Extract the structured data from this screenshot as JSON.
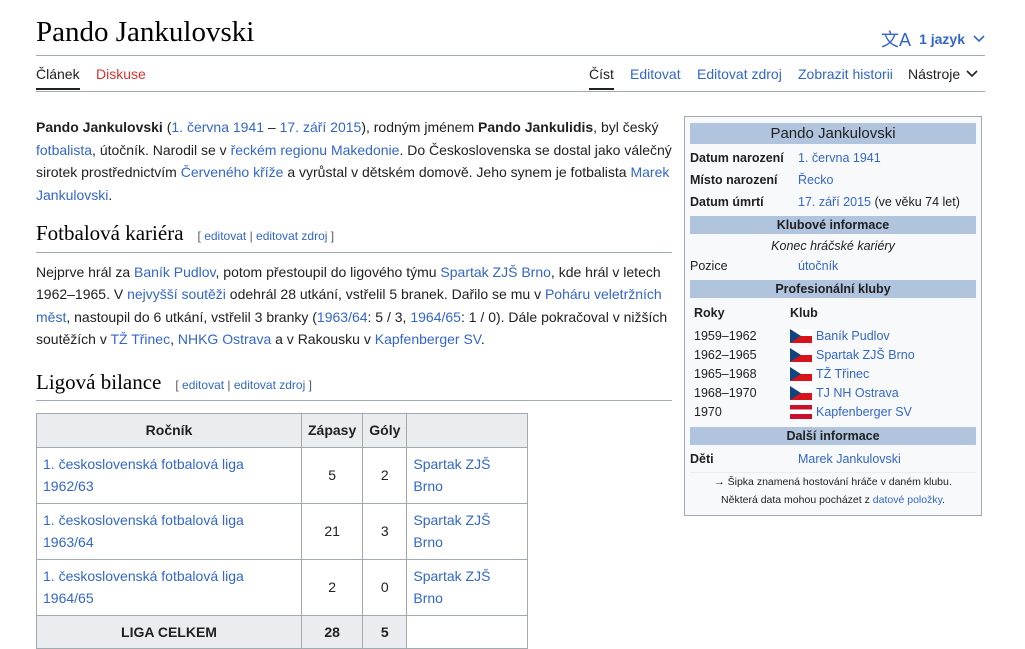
{
  "page": {
    "title": "Pando Jankulovski",
    "language_button": "1 jazyk",
    "language_icon": "translate-icon",
    "chevron_icon": "chevron-down-icon"
  },
  "tabs": {
    "article": "Článek",
    "discussion": "Diskuse",
    "read": "Číst",
    "edit": "Editovat",
    "edit_source": "Editovat zdroj",
    "history": "Zobrazit historii",
    "tools": "Nástroje"
  },
  "intro": {
    "name_bold": "Pando Jankulovski",
    "paren_open": " (",
    "birth_link": "1. června 1941",
    "dash": " – ",
    "death_link": "17. září 2015",
    "text1": "), rodným jménem ",
    "birth_name": "Pando Jankulidis",
    "text2": ", byl český ",
    "footballer_link": "fotbalista",
    "text3": ", útočník. Narodil se v ",
    "region_link": "řeckém regionu Makedonie",
    "text4": ". Do Československa se dostal jako válečný sirotek prostřednictvím ",
    "redcross_link": "Červeného kříže",
    "text5": " a vyrůstal v dětském domově. Jeho synem je fotbalista ",
    "son_link": "Marek Jankulovski",
    "text6": "."
  },
  "career": {
    "heading": "Fotbalová kariéra",
    "edit_open": "[ ",
    "edit": "editovat",
    "sep": " | ",
    "edit_source": "editovat zdroj",
    "edit_close": " ]",
    "t1": "Nejprve hrál za ",
    "l1": "Baník Pudlov",
    "t2": ", potom přestoupil do ligového týmu ",
    "l2": "Spartak ZJŠ Brno",
    "t3": ", kde hrál v letech 1962–1965. V ",
    "l3": "nejvyšší soutěži",
    "t4": " odehrál 28 utkání, vstřelil 5 branek. Dařilo se mu v ",
    "l4": "Poháru veletržních měst",
    "t5": ", nastoupil do 6 utkání, vstřelil 3 branky (",
    "l5": "1963/64",
    "t6": ": 5 / 3, ",
    "l6": "1964/65",
    "t7": ": 1 / 0). Dále pokračoval v nižších soutěžích v ",
    "l7": "TŽ Třinec",
    "t8": ", ",
    "l8": "NHKG Ostrava",
    "t9": " a v Rakousku v ",
    "l9": "Kapfenberger SV",
    "t10": "."
  },
  "league": {
    "heading": "Ligová bilance",
    "edit_open": "[ ",
    "edit": "editovat",
    "sep": " | ",
    "edit_source": "editovat zdroj",
    "edit_close": " ]",
    "headers": [
      "Ročník",
      "Zápasy",
      "Góly",
      ""
    ],
    "rows": [
      {
        "season": "1. československá fotbalová liga 1962/63",
        "apps": "5",
        "goals": "2",
        "club": "Spartak ZJŠ Brno"
      },
      {
        "season": "1. československá fotbalová liga 1963/64",
        "apps": "21",
        "goals": "3",
        "club": "Spartak ZJŠ Brno"
      },
      {
        "season": "1. československá fotbalová liga 1964/65",
        "apps": "2",
        "goals": "0",
        "club": "Spartak ZJŠ Brno"
      }
    ],
    "total": {
      "label": "LIGA CELKEM",
      "apps": "28",
      "goals": "5"
    }
  },
  "infobox": {
    "name": "Pando Jankulovski",
    "birth_label": "Datum narození",
    "birth_value": "1. června 1941",
    "place_label": "Místo narození",
    "place_value": "Řecko",
    "death_label": "Datum úmrtí",
    "death_value": "17. září 2015",
    "death_age": " (ve věku 74 let)",
    "club_info": "Klubové informace",
    "career_end": "Konec hráčské kariéry",
    "position_label": "Pozice",
    "position_value": "útočník",
    "pro_clubs": "Profesionální kluby",
    "col_years": "Roky",
    "col_club": "Klub",
    "clubs": [
      {
        "years": "1959–1962",
        "club": "Baník Pudlov",
        "flag": "cz"
      },
      {
        "years": "1962–1965",
        "club": "Spartak ZJŠ Brno",
        "flag": "cz"
      },
      {
        "years": "1965–1968",
        "club": "TŽ Třinec",
        "flag": "cz"
      },
      {
        "years": "1968–1970",
        "club": "TJ NH Ostrava",
        "flag": "cz"
      },
      {
        "years": "1970",
        "club": "Kapfenberger SV",
        "flag": "at"
      }
    ],
    "more_info": "Další informace",
    "children_label": "Děti",
    "children_value": "Marek Jankulovski",
    "note1": "→ Šipka znamená hostování hráče v daném klubu.",
    "note2_text": "Některá data mohou pocházet z ",
    "note2_link": "datové položky",
    "note2_end": "."
  }
}
